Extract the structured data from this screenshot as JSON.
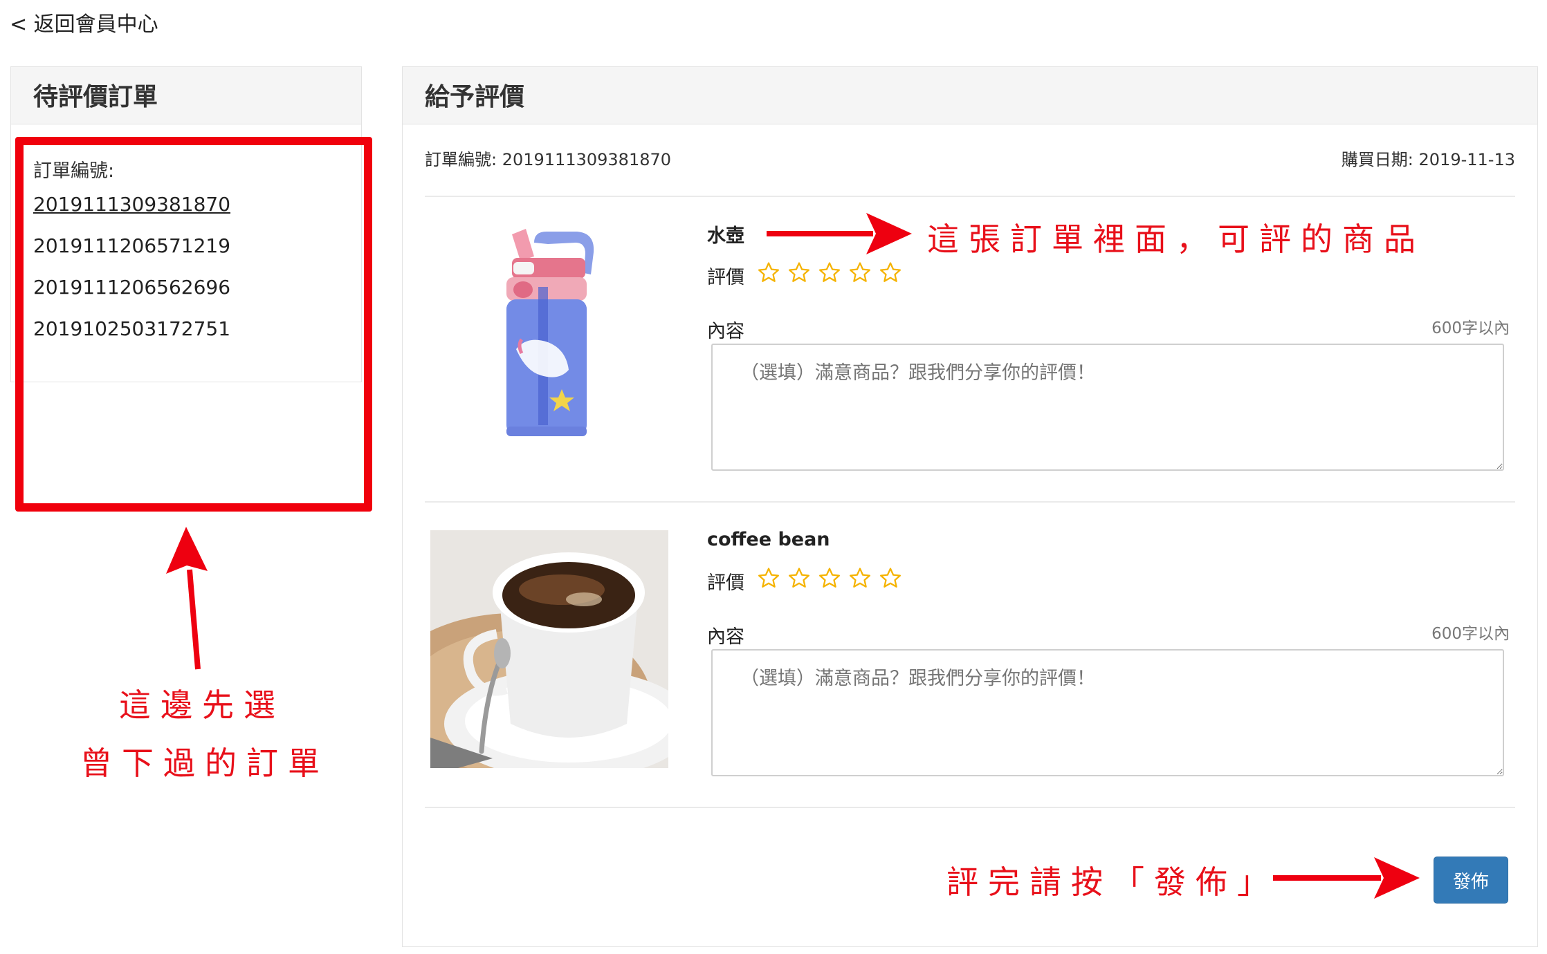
{
  "back_link": "< 返回會員中心",
  "left_panel": {
    "title": "待評價訂單",
    "order_label": "訂單編號:",
    "orders": [
      "2019111309381870",
      "2019111206571219",
      "2019111206562696",
      "2019102503172751"
    ]
  },
  "right_panel": {
    "title": "給予評價",
    "order_no": "訂單編號: 2019111309381870",
    "purchase_date": "購買日期: 2019-11-13",
    "products": [
      {
        "name": "水壺",
        "rating_label": "評價",
        "rating": 0,
        "max_rating": 5,
        "content_label": "內容",
        "limit": "600字以內",
        "placeholder": "（選填）滿意商品？跟我們分享你的評價！",
        "image": "water-bottle"
      },
      {
        "name": "coffee bean",
        "rating_label": "評價",
        "rating": 0,
        "max_rating": 5,
        "content_label": "內容",
        "limit": "600字以內",
        "placeholder": "（選填）滿意商品？跟我們分享你的評價！",
        "image": "coffee-cup"
      }
    ],
    "publish_label": "發佈"
  },
  "annotations": {
    "products_note": "這張訂單裡面，可評的商品",
    "orders_note_line1": "這邊先選",
    "orders_note_line2": "曾下過的訂單",
    "publish_note": "評完請按「發佈」"
  },
  "colors": {
    "annotation": "#e8101a",
    "star": "#f5b301",
    "publish_button": "#337ab7"
  }
}
